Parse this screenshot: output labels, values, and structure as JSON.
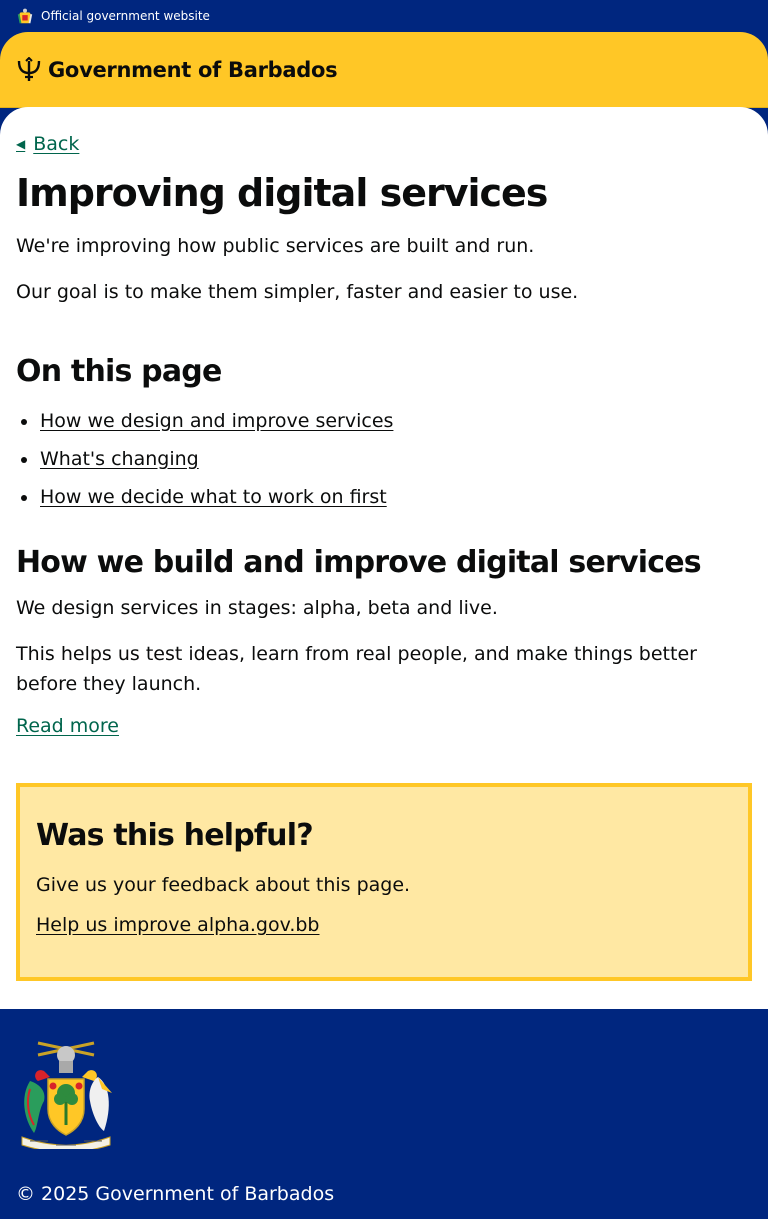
{
  "banner": {
    "text": "Official government website",
    "icon": "coat-of-arms-icon"
  },
  "header": {
    "title": "Government of Barbados",
    "icon": "trident-icon"
  },
  "back": {
    "label": "Back",
    "icon": "arrow-left-icon"
  },
  "page": {
    "title": "Improving digital services",
    "intro": [
      "We're improving how public services are built and run.",
      "Our goal is to make them simpler, faster and easier to use."
    ]
  },
  "toc": {
    "heading": "On this page",
    "items": [
      "How we design and improve services",
      "What's changing",
      "How we decide what to work on first"
    ]
  },
  "section": {
    "heading": "How we build and improve digital services",
    "paragraphs": [
      "We design services in stages: alpha, beta and live.",
      "This helps us test ideas, learn from real people, and make things better before they launch."
    ],
    "link": "Read more"
  },
  "feedback": {
    "heading": "Was this helpful?",
    "text": "Give us your feedback about this page.",
    "link": "Help us improve alpha.gov.bb"
  },
  "footer": {
    "copyright": "© 2025 Government of Barbados",
    "icon": "coat-of-arms-icon"
  },
  "colors": {
    "navy": "#00267f",
    "gold": "#ffc726",
    "gold_light": "#ffe8a3",
    "link_green": "#00654c"
  }
}
